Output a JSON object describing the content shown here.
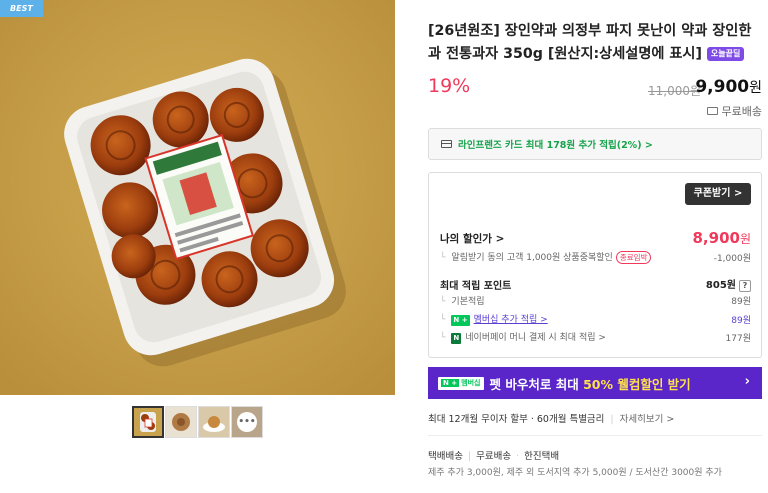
{
  "gallery": {
    "best_label": "BEST"
  },
  "product": {
    "title": "[26년원조] 장인약과 의정부 파지 못난이 약과 장인한과 전통과자 350g [원산지:상세설명에 표시]",
    "today_badge": "오늘끝딜",
    "discount_rate": "19%",
    "original_price": "11,000원",
    "sale_price": "9,900",
    "sale_price_unit": "원",
    "shipping": "무료배송"
  },
  "card_promo": {
    "text": "라인프렌즈 카드 최대 178원 추가 적립(2%) >"
  },
  "benefit_box": {
    "coupon_button": "쿠폰받기 >",
    "my_discount_label": "나의 할인가 >",
    "my_discount_price": "8,900",
    "my_discount_unit": "원",
    "alarm_text": "알림받기 동의 고객 1,000원 상품중복할인",
    "alarm_badge": "종료임박",
    "alarm_value": "-1,000원",
    "points_label": "최대 적립 포인트",
    "points_value": "805원",
    "points_help": "?",
    "basic_label": "기본적립",
    "basic_value": "89원",
    "member_badge": "N +",
    "member_label": "멤버십 추가 적립 >",
    "member_value": "89원",
    "naverpay_badge": "N",
    "naverpay_label": "네이버페이 머니 결제 시 최대 적립 >",
    "naverpay_value": "177원"
  },
  "banner": {
    "badge_n": "N +",
    "badge_text": "멤버십",
    "text_before": "펫 바우처로 최대 ",
    "text_highlight": "50% 웰컴할인 받기",
    "arrow": "›"
  },
  "installment": {
    "text": "최대 12개월 무이자 할부 · 60개월 특별금리",
    "more": "자세히보기 >"
  },
  "delivery": {
    "type": "택배배송",
    "fee": "무료배송",
    "carrier": "한진택배",
    "note": "제주 추가 3,000원, 제주 외 도서지역 추가 5,000원 / 도서산간 3000원 추가"
  }
}
